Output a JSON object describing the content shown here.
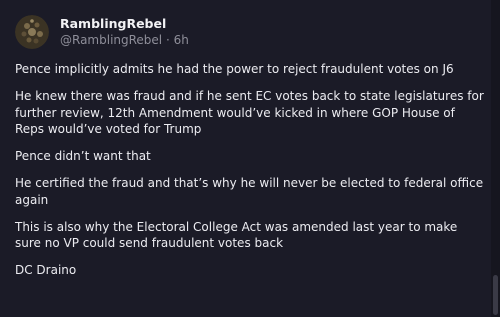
{
  "post": {
    "author": {
      "display_name": "RamblingRebel",
      "handle": "@RamblingRebel",
      "separator": " · ",
      "time": "6h"
    },
    "paragraphs": [
      "Pence implicitly admits he had the power to reject fraudulent votes on J6",
      "He knew there was fraud and if he sent EC votes back to state legislatures for further review, 12th Amendment would’ve kicked in where GOP House of Reps would’ve voted for Trump",
      "Pence didn’t want that",
      "He certified the fraud and that’s why he will never be elected to federal office again",
      "This is also why the Electoral College Act was amended last year to make sure no VP could send fraudulent votes back",
      "DC Draino"
    ]
  },
  "colors": {
    "background": "#1b1b27",
    "text": "#ececf1",
    "muted": "#8e8e99"
  }
}
